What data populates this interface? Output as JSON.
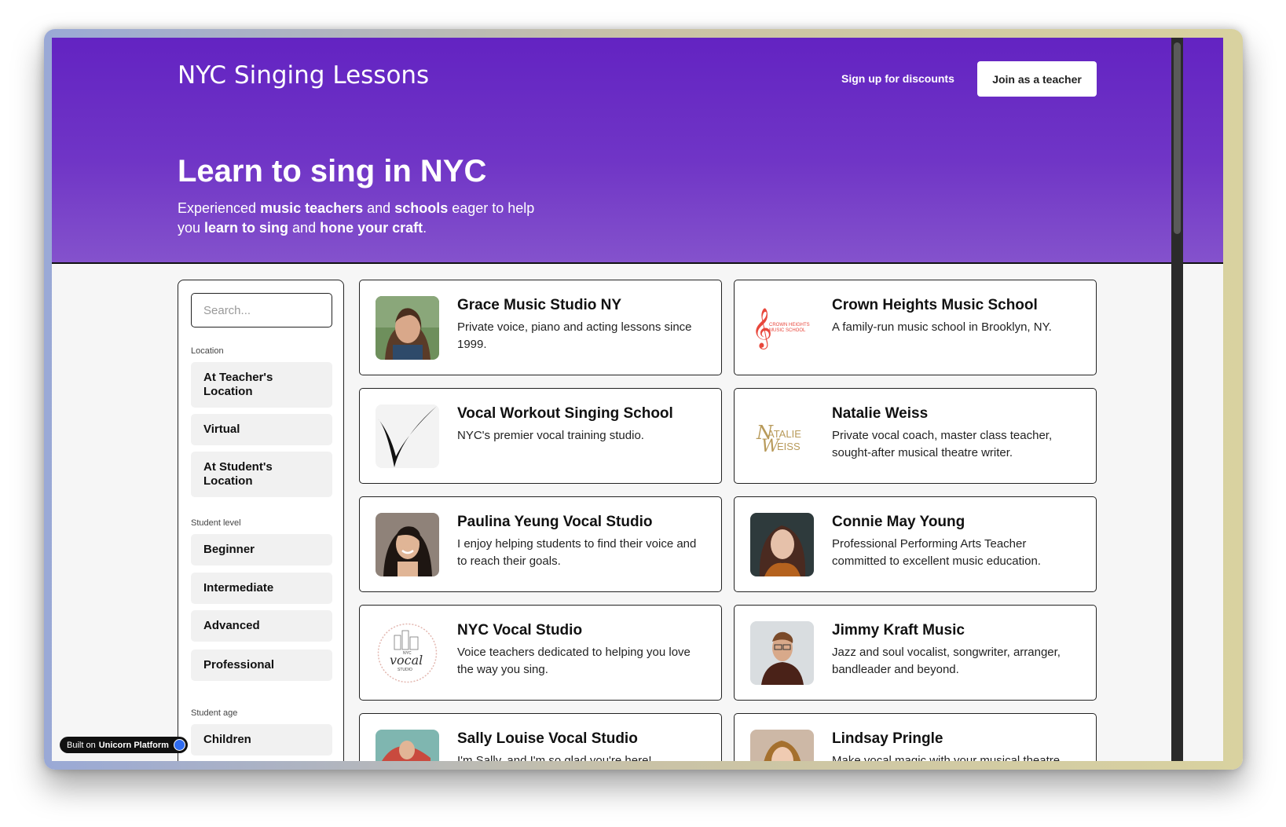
{
  "header": {
    "brand": "NYC Singing Lessons",
    "nav_link": "Sign up for discounts",
    "join_button": "Join as a teacher"
  },
  "hero": {
    "title": "Learn to sing in NYC",
    "subtitle_parts": [
      "Experienced ",
      "music teachers",
      " and ",
      "schools",
      " eager to help you ",
      "learn to sing",
      " and ",
      "hone your craft",
      "."
    ]
  },
  "sidebar": {
    "search_placeholder": "Search...",
    "location_label": "Location",
    "location_options": [
      "At Teacher's Location",
      "Virtual",
      "At Student's Location"
    ],
    "level_label": "Student level",
    "level_options": [
      "Beginner",
      "Intermediate",
      "Advanced",
      "Professional"
    ],
    "age_label": "Student age",
    "age_options": [
      "Children"
    ]
  },
  "listings": [
    {
      "title": "Grace Music Studio NY",
      "desc": "Private voice, piano and acting lessons since 1999.",
      "image": "portrait-photo"
    },
    {
      "title": "Crown Heights Music School",
      "desc": "A family-run music school in Brooklyn, NY.",
      "image": "treble-clef-logo"
    },
    {
      "title": "Vocal Workout Singing School",
      "desc": "NYC's premier vocal training studio.",
      "image": "v-logo"
    },
    {
      "title": "Natalie Weiss",
      "desc": "Private vocal coach, master class teacher, sought-after musical theatre writer.",
      "image": "nw-logo"
    },
    {
      "title": "Paulina Yeung Vocal Studio",
      "desc": "I enjoy helping students to find their voice and to reach their goals.",
      "image": "portrait-photo"
    },
    {
      "title": "Connie May Young",
      "desc": "Professional Performing Arts Teacher committed to excellent music education.",
      "image": "portrait-photo"
    },
    {
      "title": "NYC Vocal Studio",
      "desc": "Voice teachers dedicated to helping you love the way you sing.",
      "image": "vocal-studio-logo"
    },
    {
      "title": "Jimmy Kraft Music",
      "desc": "Jazz and soul vocalist, songwriter, arranger, bandleader and beyond.",
      "image": "portrait-photo"
    },
    {
      "title": "Sally Louise Vocal Studio",
      "desc": "I'm Sally, and I'm so glad you're here!",
      "image": "portrait-photo"
    },
    {
      "title": "Lindsay Pringle",
      "desc": "Make vocal magic with your musical theatre",
      "image": "portrait-photo"
    }
  ],
  "logo_text": {
    "crown_heights": "CROWN HEIGHTS MUSIC SCHOOL",
    "natalie_weiss": "NATALIE WEISS",
    "nyc_vocal": "NYC vocal STUDIO"
  },
  "badge": {
    "prefix": "Built on ",
    "name": "Unicorn Platform"
  },
  "colors": {
    "hero_top": "#6323c2",
    "hero_bottom": "#8452cc",
    "accent_red": "#e8473c",
    "gold": "#b89a5a"
  }
}
